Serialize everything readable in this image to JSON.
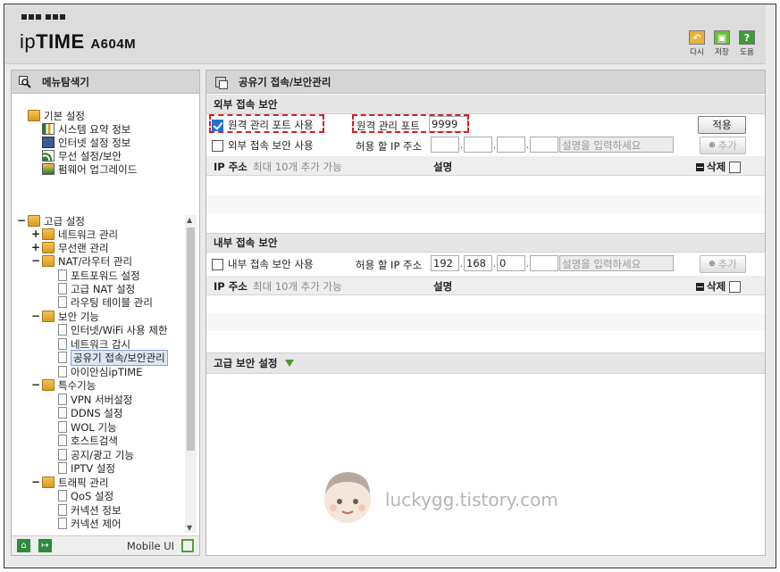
{
  "header": {
    "brand_prefix": "ip",
    "brand_strong": "TIME",
    "model": "A604M",
    "tools": [
      {
        "name": "undo",
        "label": "다시",
        "icon": "undo-icon",
        "color": "#e7b23a"
      },
      {
        "name": "save",
        "label": "저장",
        "icon": "save-icon",
        "color": "#6cbf3a"
      },
      {
        "name": "help",
        "label": "도움",
        "icon": "help-icon",
        "color": "#3f9a3a",
        "glyph": "?"
      }
    ]
  },
  "sidebar": {
    "title": "메뉴탐색기",
    "basic": {
      "label": "기본 설정",
      "items": [
        "시스템 요약 정보",
        "인터넷 설정 정보",
        "무선 설정/보안",
        "펌웨어 업그레이드"
      ]
    },
    "advanced": {
      "label": "고급 설정",
      "groups": [
        {
          "label": "네트워크 관리",
          "expand": "+"
        },
        {
          "label": "무선랜 관리",
          "expand": "+"
        },
        {
          "label": "NAT/라우터 관리",
          "expand": "−",
          "items": [
            "포트포워드 설정",
            "고급 NAT 설정",
            "라우팅 테이블 관리"
          ]
        },
        {
          "label": "보안 기능",
          "expand": "−",
          "items": [
            "인터넷/WiFi 사용 제한",
            "네트워크 감시",
            "공유기 접속/보안관리",
            "아이안심ipTIME"
          ]
        },
        {
          "label": "특수기능",
          "expand": "−",
          "items": [
            "VPN 서버설정",
            "DDNS 설정",
            "WOL 기능",
            "호스트검색",
            "공지/광고 기능",
            "IPTV 설정"
          ]
        },
        {
          "label": "트래픽 관리",
          "expand": "−",
          "items": [
            "QoS 설정",
            "커넥션 정보",
            "커넥션 제어"
          ]
        }
      ]
    },
    "selected_item": "공유기 접속/보안관리",
    "footer": {
      "mobile_label": "Mobile UI"
    }
  },
  "main": {
    "title": "공유기 접속/보안관리",
    "external": {
      "section_title": "외부 접속 보안",
      "remote_port_checkbox_label": "원격 관리 포트 사용",
      "remote_port_checked": true,
      "remote_port_label": "원격 관리 포트",
      "remote_port_value": "9999",
      "apply_label": "적용",
      "security_checkbox_label": "외부 접속 보안 사용",
      "allowed_ip_label": "허용 할 IP 주소",
      "ip_octets": [
        "",
        "",
        "",
        ""
      ],
      "desc_placeholder": "설명을 입력하세요",
      "add_label": "추가",
      "table": {
        "ip_header": "IP 주소",
        "ip_hint": "최대 10개 추가 가능",
        "desc_header": "설명",
        "delete_label": "삭제"
      }
    },
    "internal": {
      "section_title": "내부 접속 보안",
      "security_checkbox_label": "내부 접속 보안 사용",
      "allowed_ip_label": "허용 할 IP 주소",
      "ip_octets": [
        "192",
        "168",
        "0",
        ""
      ],
      "desc_placeholder": "설명을 입력하세요",
      "add_label": "추가",
      "table": {
        "ip_header": "IP 주소",
        "ip_hint": "최대 10개 추가 가능",
        "desc_header": "설명",
        "delete_label": "삭제"
      }
    },
    "advanced_security_label": "고급 보안 설정"
  },
  "watermark": {
    "text": "luckygg.tistory.com"
  }
}
